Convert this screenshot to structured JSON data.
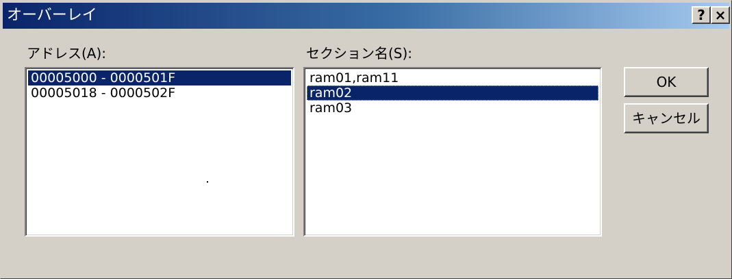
{
  "window": {
    "title": "オーバーレイ",
    "help_button": "?",
    "close_button": "×"
  },
  "address": {
    "label": "アドレス(A):",
    "items": [
      "00005000 - 0000501F",
      "00005018 - 0000502F"
    ],
    "selected_index": 0
  },
  "section": {
    "label": "セクション名(S):",
    "items": [
      "ram01,ram11",
      "ram02",
      "ram03"
    ],
    "selected_index": 1
  },
  "buttons": {
    "ok": "OK",
    "cancel": "キャンセル"
  },
  "colors": {
    "title_start": "#0a246a",
    "title_end": "#a6caf0",
    "selection": "#0a246a",
    "face": "#d4d0c8"
  }
}
